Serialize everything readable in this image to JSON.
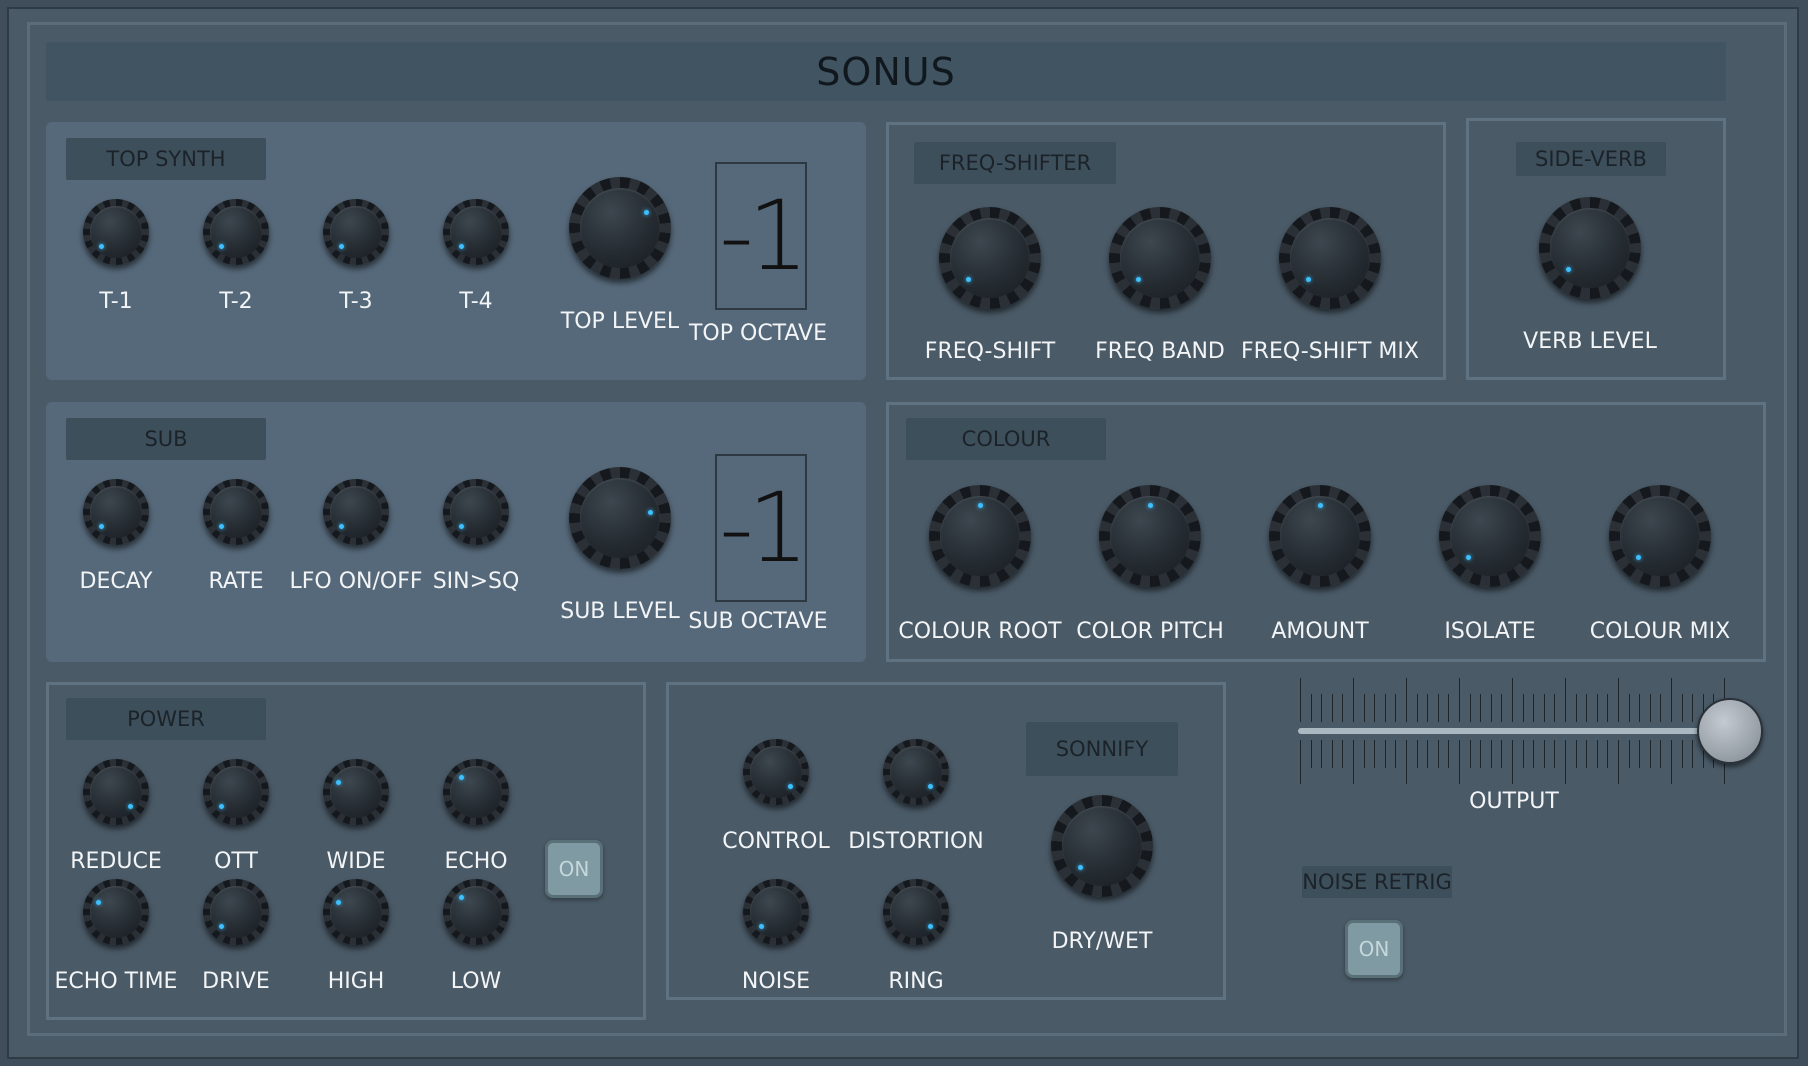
{
  "app": {
    "title": "SONUS"
  },
  "sections": {
    "top_synth": "TOP SYNTH",
    "sub": "SUB",
    "power": "POWER",
    "freq_shifter": "FREQ-SHIFTER",
    "side_verb": "SIDE-VERB",
    "colour": "COLOUR",
    "sonnify": "SONNIFY",
    "noise_retrig": "NOISE RETRIG"
  },
  "top_synth": {
    "knobs": [
      "T-1",
      "T-2",
      "T-3",
      "T-4"
    ],
    "level": "TOP LEVEL",
    "octave_label": "TOP OCTAVE",
    "octave_value": "-1"
  },
  "sub": {
    "knobs": [
      "DECAY",
      "RATE",
      "LFO ON/OFF",
      "SIN>SQ"
    ],
    "level": "SUB LEVEL",
    "octave_label": "SUB OCTAVE",
    "octave_value": "-1"
  },
  "power": {
    "row1": [
      "REDUCE",
      "OTT",
      "WIDE",
      "ECHO"
    ],
    "row2": [
      "ECHO TIME",
      "DRIVE",
      "HIGH",
      "LOW"
    ],
    "toggle": "ON"
  },
  "freq_shifter": {
    "knobs": [
      "FREQ-SHIFT",
      "FREQ BAND",
      "FREQ-SHIFT MIX"
    ]
  },
  "side_verb": {
    "knobs": [
      "VERB LEVEL"
    ]
  },
  "colour": {
    "knobs": [
      "COLOUR ROOT",
      "COLOR PITCH",
      "AMOUNT",
      "ISOLATE",
      "COLOUR MIX"
    ]
  },
  "fx": {
    "knobs": [
      "CONTROL",
      "DISTORTION",
      "NOISE",
      "RING"
    ],
    "dry_wet": "DRY/WET"
  },
  "output": {
    "label": "OUTPUT",
    "level": 1.0
  },
  "noise_retrig": {
    "toggle": "ON"
  },
  "colors": {
    "accent_dot": "#3ec0ff",
    "panel": "#56697a",
    "background": "#4a5a67"
  }
}
